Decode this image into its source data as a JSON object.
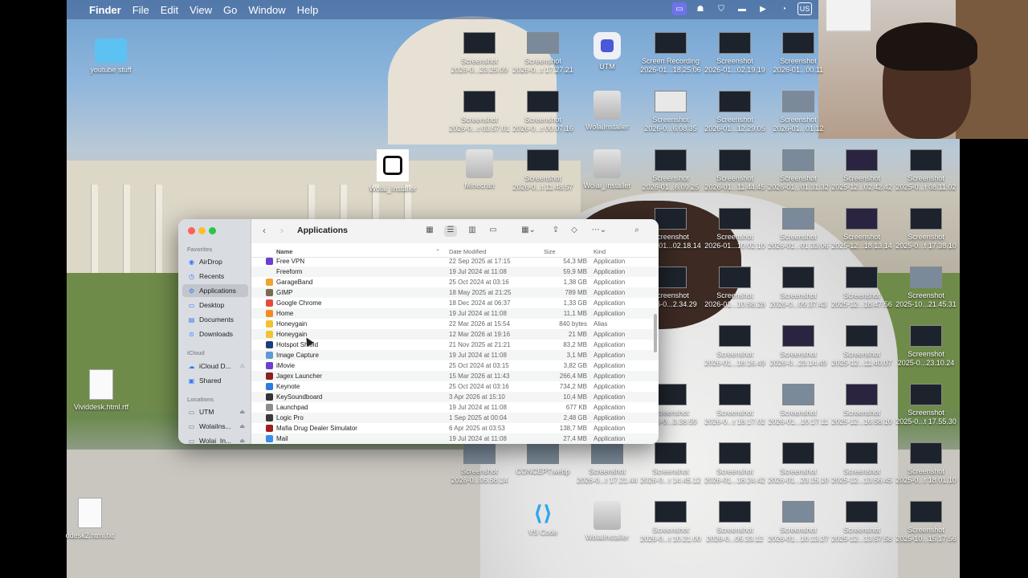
{
  "menubar": {
    "app": "Finder",
    "items": [
      "File",
      "Edit",
      "View",
      "Go",
      "Window",
      "Help"
    ],
    "language": "US"
  },
  "desktop_icons": [
    {
      "label": "youtube stuff",
      "kind": "folder"
    },
    {
      "label": "Screenshot\n2026-0...23.25.09",
      "kind": "thumb"
    },
    {
      "label": "Screenshot\n2026-0...t 17.27.21",
      "kind": "photo"
    },
    {
      "label": "UTM",
      "kind": "utm"
    },
    {
      "label": "Screen Recording\n2026-01...18.25.06",
      "kind": "thumb"
    },
    {
      "label": "Screenshot\n2026-01...02.19.19",
      "kind": "thumb"
    },
    {
      "label": "Screenshot\n2026-01...00.11",
      "kind": "thumb"
    },
    {
      "label": "Screenshot\n2026-0...t 03.57.01",
      "kind": "thumb"
    },
    {
      "label": "Screenshot\n2026-0...t 00.07.16",
      "kind": "thumb"
    },
    {
      "label": "WolaiInstaller",
      "kind": "drive"
    },
    {
      "label": "Screenshot\n2026-0...6.08.35",
      "kind": "light"
    },
    {
      "label": "Screenshot\n2026-01...12.29.05",
      "kind": "thumb"
    },
    {
      "label": "Screenshot\n2026-01...01.12",
      "kind": "photo"
    },
    {
      "label": "Wolai_Installer",
      "kind": "wolai"
    },
    {
      "label": "Minecraft",
      "kind": "drive"
    },
    {
      "label": "Screenshot\n2026-0...t 11.48.57",
      "kind": "thumb"
    },
    {
      "label": "Wolai_Installer",
      "kind": "drive"
    },
    {
      "label": "Screenshot\n2026-01...6.09.25",
      "kind": "thumb"
    },
    {
      "label": "Screenshot\n2026-01...11.44.45",
      "kind": "thumb"
    },
    {
      "label": "Screenshot\n2026-01...01.31.32",
      "kind": "photo"
    },
    {
      "label": "Screenshot\n2025-12...02.42.42",
      "kind": "dark2"
    },
    {
      "label": "Screenshot\n2025-0...t 08.11.02",
      "kind": "thumb"
    },
    {
      "label": "Screenshot\n2026-01...02.18.14",
      "kind": "thumb"
    },
    {
      "label": "Screenshot\n2026-01...10.02.10",
      "kind": "thumb"
    },
    {
      "label": "Screenshot\n2026-01...01.33.06",
      "kind": "photo"
    },
    {
      "label": "Screenshot\n2025-12...18.13.14",
      "kind": "dark2"
    },
    {
      "label": "Screenshot\n2025-0...t 17.38.10",
      "kind": "thumb"
    },
    {
      "label": "Screenshot\n2026-0...2.34.29",
      "kind": "thumb"
    },
    {
      "label": "Screenshot\n2026-01...10.58.28",
      "kind": "thumb"
    },
    {
      "label": "Screenshot\n2026-0...09.37.43",
      "kind": "thumb"
    },
    {
      "label": "Screenshot\n2025-12...18.47.56",
      "kind": "thumb"
    },
    {
      "label": "Screenshot\n2025-10...21.45.31",
      "kind": "photo"
    },
    {
      "label": "Screenshot\n2026-01...18.16.49",
      "kind": "thumb"
    },
    {
      "label": "Screenshot\n2026-0...23.14.49",
      "kind": "dark2"
    },
    {
      "label": "Screenshot\n2025-12...11.40.07",
      "kind": "thumb"
    },
    {
      "label": "Screenshot\n2025-0...23.10.24",
      "kind": "thumb"
    },
    {
      "label": "Vividdesk.html.rtf",
      "kind": "doc"
    },
    {
      "label": "Screenshot\n2026-0...3.38.59",
      "kind": "thumb"
    },
    {
      "label": "Screenshot\n2026-0...t 18.17.02",
      "kind": "thumb"
    },
    {
      "label": "Screenshot\n2026-01...10.17.11",
      "kind": "photo"
    },
    {
      "label": "Screenshot\n2025-12...16.58.10",
      "kind": "dark2"
    },
    {
      "label": "Screenshot\n2025-0...t 17.55.30",
      "kind": "thumb"
    },
    {
      "label": "Screenshot\n2026-0...05.58.14",
      "kind": "photo"
    },
    {
      "label": "CONCEPT.webp",
      "kind": "photo"
    },
    {
      "label": "Screenshot\n2026-0...t 17.21.44",
      "kind": "photo"
    },
    {
      "label": "Screenshot\n2026-0...t 14.45.12",
      "kind": "thumb"
    },
    {
      "label": "Screenshot\n2026-01...18.24.42",
      "kind": "thumb"
    },
    {
      "label": "Screenshot\n2026-01...23.15.10",
      "kind": "thumb"
    },
    {
      "label": "Screenshot\n2025-12...13.56.45",
      "kind": "thumb"
    },
    {
      "label": "Screenshot\n2025-0...t 18.01.10",
      "kind": "thumb"
    },
    {
      "label": "ddesk2.html.txt",
      "kind": "doc"
    },
    {
      "label": "VS Code",
      "kind": "vscode"
    },
    {
      "label": "WolaiInstaller",
      "kind": "drive"
    },
    {
      "label": "Screenshot\n2026-0...t 10.21.00",
      "kind": "thumb"
    },
    {
      "label": "Screenshot\n2026-0...05.33.12",
      "kind": "thumb"
    },
    {
      "label": "Screenshot\n2026-01...10.13.27",
      "kind": "photo"
    },
    {
      "label": "Screenshot\n2025-12...13.57.58",
      "kind": "thumb"
    },
    {
      "label": "Screenshot\n2025-10...15.17.56",
      "kind": "thumb"
    }
  ],
  "finder": {
    "title": "Applications",
    "sidebar": {
      "favorites_header": "Favorites",
      "favorites": [
        "AirDrop",
        "Recents",
        "Applications",
        "Desktop",
        "Documents",
        "Downloads"
      ],
      "selected": "Applications",
      "icloud_header": "iCloud",
      "icloud": [
        "iCloud D...",
        "Shared"
      ],
      "locations_header": "Locations",
      "locations": [
        "UTM",
        "WolaiIns...",
        "Wolai_In..."
      ]
    },
    "columns": {
      "name": "Name",
      "date": "Date Modified",
      "size": "Size",
      "kind": "Kind"
    },
    "rows": [
      {
        "name": "Free VPN",
        "date": "22 Sep 2025 at 17:15",
        "size": "54,3 MB",
        "kind": "Application",
        "color": "#6b3fd1"
      },
      {
        "name": "Freeform",
        "date": "19 Jul 2024 at 11:08",
        "size": "59,9 MB",
        "kind": "Application",
        "color": "#f5f5f5"
      },
      {
        "name": "GarageBand",
        "date": "25 Oct 2024 at 03:16",
        "size": "1,38 GB",
        "kind": "Application",
        "color": "#f0a431"
      },
      {
        "name": "GIMP",
        "date": "18 May 2025 at 21:25",
        "size": "789 MB",
        "kind": "Application",
        "color": "#7a6a55"
      },
      {
        "name": "Google Chrome",
        "date": "18 Dec 2024 at 06:37",
        "size": "1,33 GB",
        "kind": "Application",
        "color": "#e84b3c"
      },
      {
        "name": "Home",
        "date": "19 Jul 2024 at 11:08",
        "size": "11,1 MB",
        "kind": "Application",
        "color": "#f58b1f"
      },
      {
        "name": "Honeygain",
        "date": "22 Mar 2026 at 15:54",
        "size": "840 bytes",
        "kind": "Alias",
        "color": "#f2c230"
      },
      {
        "name": "Honeygain",
        "date": "12 Mar 2026 at 19:16",
        "size": "21 MB",
        "kind": "Application",
        "color": "#f2c230"
      },
      {
        "name": "Hotspot Shield",
        "date": "21 Nov 2025 at 21:21",
        "size": "83,2 MB",
        "kind": "Application",
        "color": "#1b3f7a"
      },
      {
        "name": "Image Capture",
        "date": "19 Jul 2024 at 11:08",
        "size": "3,1 MB",
        "kind": "Application",
        "color": "#5a9bd6"
      },
      {
        "name": "iMovie",
        "date": "25 Oct 2024 at 03:15",
        "size": "3,82 GB",
        "kind": "Application",
        "color": "#6d3fd1"
      },
      {
        "name": "Jagex Launcher",
        "date": "15 Mar 2026 at 11:43",
        "size": "266,4 MB",
        "kind": "Application",
        "color": "#8a1f1f"
      },
      {
        "name": "Keynote",
        "date": "25 Oct 2024 at 03:16",
        "size": "734,2 MB",
        "kind": "Application",
        "color": "#2d7be0"
      },
      {
        "name": "KeySoundboard",
        "date": "3 Apr 2026 at 15:10",
        "size": "10,4 MB",
        "kind": "Application",
        "color": "#333333"
      },
      {
        "name": "Launchpad",
        "date": "19 Jul 2024 at 11:08",
        "size": "677 KB",
        "kind": "Application",
        "color": "#8c8c8c"
      },
      {
        "name": "Logic Pro",
        "date": "1 Sep 2025 at 00:04",
        "size": "2,48 GB",
        "kind": "Application",
        "color": "#3a3a3a"
      },
      {
        "name": "Mafia Drug Dealer Simulator",
        "date": "6 Apr 2025 at 03:53",
        "size": "138,7 MB",
        "kind": "Application",
        "color": "#a01e1e"
      },
      {
        "name": "Mail",
        "date": "19 Jul 2024 at 11:08",
        "size": "27,4 MB",
        "kind": "Application",
        "color": "#3b8ee8"
      }
    ]
  }
}
